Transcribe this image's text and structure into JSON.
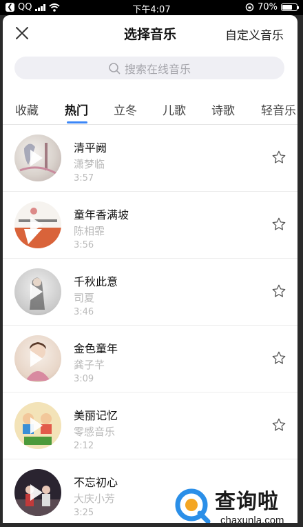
{
  "status_bar": {
    "carrier": "QQ",
    "time": "下午4:07",
    "battery": "70%",
    "battery_level": 0.7
  },
  "header": {
    "title": "选择音乐",
    "custom_label": "自定义音乐"
  },
  "search": {
    "placeholder": "搜索在线音乐"
  },
  "tabs": [
    "收藏",
    "热门",
    "立冬",
    "儿歌",
    "诗歌",
    "轻音乐"
  ],
  "active_tab": "热门",
  "colors": {
    "accent": "#3b86f7",
    "subtext": "#b9b9b9"
  },
  "songs": [
    {
      "title": "清平阙",
      "artist": "潇梦临",
      "duration": "3:57"
    },
    {
      "title": "童年香满坡",
      "artist": "陈相霏",
      "duration": "3:56"
    },
    {
      "title": "千秋此意",
      "artist": "司夏",
      "duration": "3:46"
    },
    {
      "title": "金色童年",
      "artist": "龚子芊",
      "duration": "3:09"
    },
    {
      "title": "美丽记忆",
      "artist": "零感音乐",
      "duration": "2:12"
    },
    {
      "title": "不忘初心",
      "artist": "大庆小芳",
      "duration": "3:25"
    }
  ],
  "watermark": {
    "text": "查询啦",
    "url": "chaxunla.com"
  }
}
